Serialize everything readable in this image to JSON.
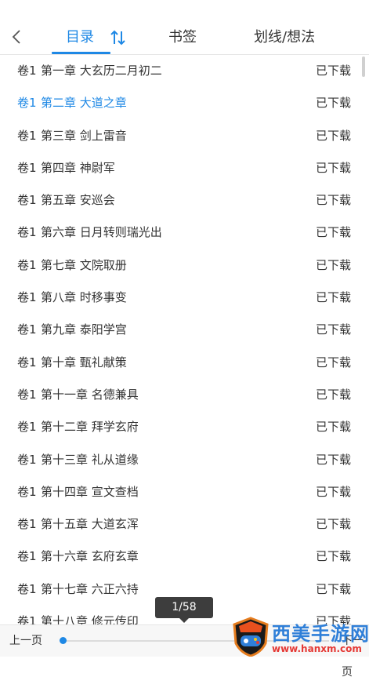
{
  "header": {
    "tabs": [
      "目录",
      "书签",
      "划线/想法"
    ],
    "active_color": "#1e88e5"
  },
  "chapters": [
    {
      "vol": "卷1",
      "title": "第一章 大玄历二月初二",
      "status": "已下载"
    },
    {
      "vol": "卷1",
      "title": "第二章 大道之章",
      "status": "已下载"
    },
    {
      "vol": "卷1",
      "title": "第三章 剑上雷音",
      "status": "已下载"
    },
    {
      "vol": "卷1",
      "title": "第四章 神尉军",
      "status": "已下载"
    },
    {
      "vol": "卷1",
      "title": "第五章 安巡会",
      "status": "已下载"
    },
    {
      "vol": "卷1",
      "title": "第六章 日月转则瑞光出",
      "status": "已下载"
    },
    {
      "vol": "卷1",
      "title": "第七章 文院取册",
      "status": "已下载"
    },
    {
      "vol": "卷1",
      "title": "第八章 时移事变",
      "status": "已下载"
    },
    {
      "vol": "卷1",
      "title": "第九章 泰阳学宫",
      "status": "已下载"
    },
    {
      "vol": "卷1",
      "title": "第十章 甄礼献策",
      "status": "已下载"
    },
    {
      "vol": "卷1",
      "title": "第十一章 名德兼具",
      "status": "已下载"
    },
    {
      "vol": "卷1",
      "title": "第十二章 拜学玄府",
      "status": "已下载"
    },
    {
      "vol": "卷1",
      "title": "第十三章 礼从道缘",
      "status": "已下载"
    },
    {
      "vol": "卷1",
      "title": "第十四章 宣文查档",
      "status": "已下载"
    },
    {
      "vol": "卷1",
      "title": "第十五章 大道玄浑",
      "status": "已下载"
    },
    {
      "vol": "卷1",
      "title": "第十六章 玄府玄章",
      "status": "已下载"
    },
    {
      "vol": "卷1",
      "title": "第十七章 六正六持",
      "status": "已下载"
    },
    {
      "vol": "卷1",
      "title": "第十八章 修元传印",
      "status": "已下载"
    }
  ],
  "current_index": 1,
  "pager": {
    "prev_label": "上一页",
    "next_label": "下一页",
    "page_indicator": "1/58",
    "progress": 0.0
  },
  "watermark": {
    "text": "西美手游网",
    "url": "www.hanxm.com"
  }
}
